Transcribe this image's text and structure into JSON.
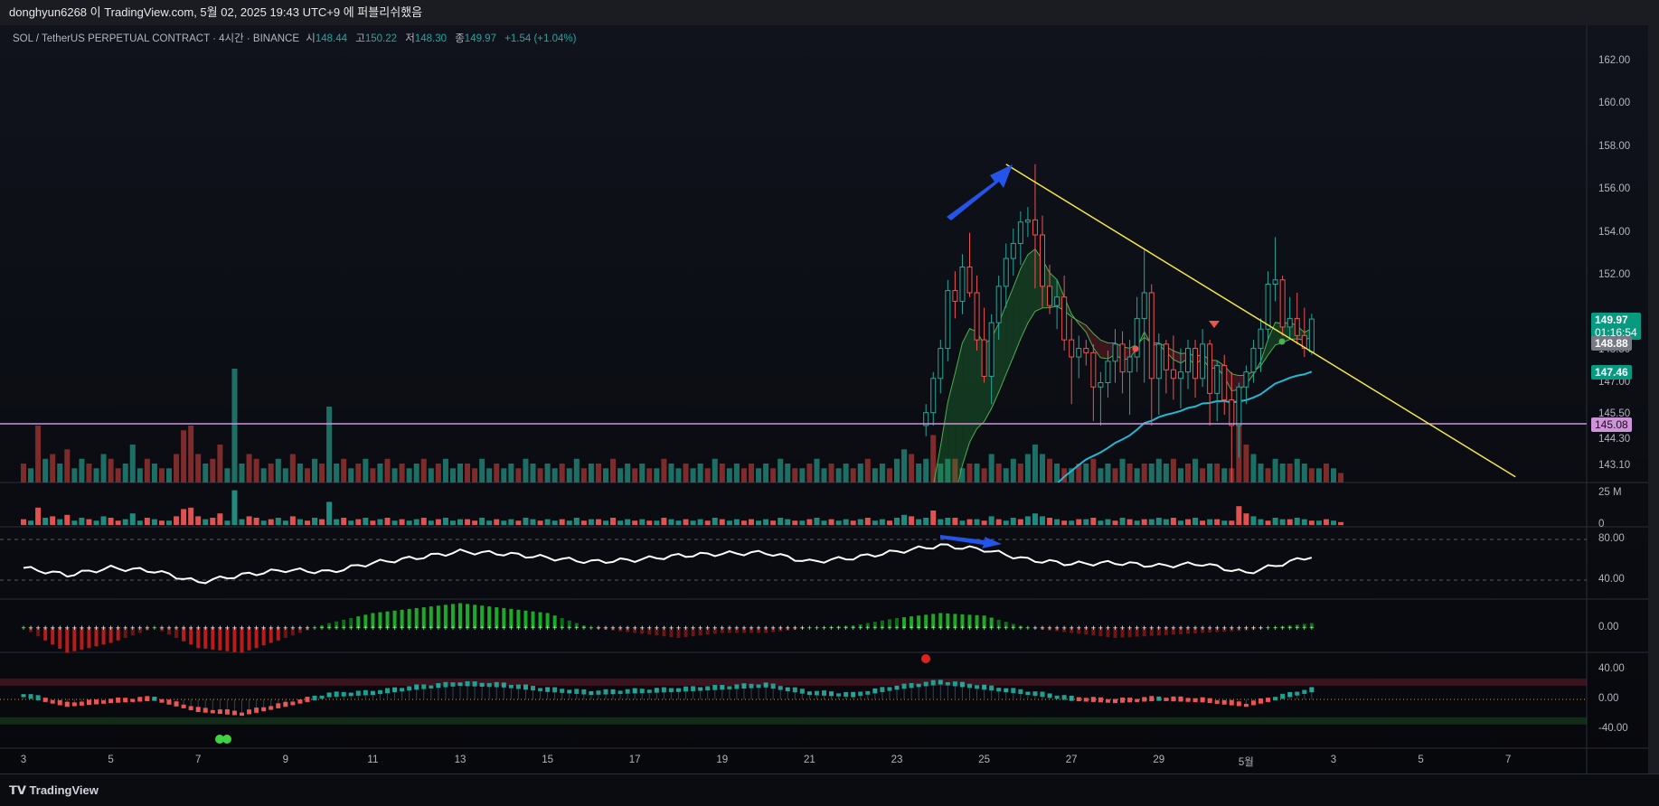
{
  "header": {
    "text": "donghyun6268 이 TradingView.com, 5월 02, 2025 19:43 UTC+9 에 퍼블리쉬했음"
  },
  "legend": {
    "symbol": "SOL / TetherUS PERPETUAL CONTRACT · 4시간 · BINANCE",
    "open_label": "시",
    "open": "148.44",
    "high_label": "고",
    "high": "150.22",
    "low_label": "저",
    "low": "148.30",
    "close_label": "종",
    "close": "149.97",
    "change": "+1.54 (+1.04%)"
  },
  "price_axis": [
    "162.00",
    "160.00",
    "158.00",
    "156.00",
    "154.00",
    "152.00",
    "148.50",
    "147.00",
    "145.50",
    "144.30",
    "143.10"
  ],
  "badges": {
    "last_price": "149.97",
    "countdown": "01:16:54",
    "prev": "148.88",
    "ema": "147.46",
    "hline": "145.08"
  },
  "volume_axis": [
    "25 M",
    "0"
  ],
  "rsi_axis": [
    "80.00",
    "40.00"
  ],
  "macd_axis": [
    "0.00"
  ],
  "osc_axis": [
    "40.00",
    "0.00",
    "-40.00"
  ],
  "time_axis": [
    "3",
    "5",
    "7",
    "9",
    "11",
    "13",
    "15",
    "17",
    "19",
    "21",
    "23",
    "25",
    "27",
    "29",
    "5월",
    "3",
    "5",
    "7"
  ],
  "footer": {
    "brand": "TradingView"
  },
  "colors": {
    "up": "#26a69a",
    "down": "#ef5350",
    "trendline": "#f5e642",
    "hline": "#ce93d8",
    "ema": "#22b8d6",
    "arrow": "#2455e8"
  },
  "chart_data": {
    "type": "candlestick",
    "first_candle_bar": 124,
    "candles": [
      [
        145.0,
        146.0,
        144.5,
        145.6
      ],
      [
        145.6,
        147.5,
        145.0,
        147.2
      ],
      [
        147.2,
        149.0,
        146.5,
        148.6
      ],
      [
        148.6,
        151.8,
        148.0,
        151.3
      ],
      [
        151.3,
        152.2,
        150.0,
        150.8
      ],
      [
        150.8,
        153.0,
        150.2,
        152.4
      ],
      [
        152.4,
        154.0,
        151.0,
        151.2
      ],
      [
        151.2,
        152.0,
        148.5,
        149.0
      ],
      [
        149.0,
        150.5,
        147.0,
        147.3
      ],
      [
        147.3,
        150.2,
        146.0,
        149.8
      ],
      [
        149.8,
        152.0,
        149.0,
        151.5
      ],
      [
        151.5,
        153.5,
        150.5,
        152.8
      ],
      [
        152.8,
        154.2,
        152.0,
        153.5
      ],
      [
        153.5,
        155.0,
        152.5,
        154.5
      ],
      [
        154.5,
        155.2,
        153.8,
        154.6
      ],
      [
        154.6,
        157.2,
        151.4,
        153.9
      ],
      [
        153.9,
        154.8,
        150.5,
        151.5
      ],
      [
        151.5,
        152.5,
        150.2,
        150.6
      ],
      [
        150.6,
        151.8,
        149.5,
        151.0
      ],
      [
        151.0,
        152.0,
        148.5,
        149.0
      ],
      [
        149.0,
        150.0,
        146.0,
        148.2
      ],
      [
        148.2,
        149.2,
        147.2,
        148.6
      ],
      [
        148.6,
        149.0,
        147.8,
        148.4
      ],
      [
        148.4,
        148.8,
        145.2,
        146.8
      ],
      [
        146.8,
        147.5,
        145.0,
        147.0
      ],
      [
        147.0,
        148.5,
        146.3,
        148.0
      ],
      [
        148.0,
        149.5,
        147.0,
        148.8
      ],
      [
        148.8,
        149.4,
        146.5,
        147.5
      ],
      [
        147.5,
        149.0,
        145.5,
        148.2
      ],
      [
        148.2,
        151.0,
        147.5,
        150.0
      ],
      [
        150.0,
        153.2,
        147.0,
        151.2
      ],
      [
        151.2,
        151.6,
        145.0,
        147.2
      ],
      [
        147.2,
        149.3,
        145.5,
        148.8
      ],
      [
        148.8,
        149.0,
        146.5,
        147.6
      ],
      [
        147.6,
        149.2,
        146.2,
        147.2
      ],
      [
        147.2,
        148.6,
        145.8,
        147.5
      ],
      [
        147.5,
        149.0,
        146.7,
        148.6
      ],
      [
        148.6,
        149.0,
        146.3,
        147.2
      ],
      [
        147.2,
        149.5,
        146.8,
        148.8
      ],
      [
        148.8,
        149.0,
        145.0,
        146.5
      ],
      [
        146.5,
        148.0,
        145.2,
        147.8
      ],
      [
        147.8,
        148.3,
        145.5,
        146.2
      ],
      [
        146.2,
        147.5,
        141.0,
        145.0
      ],
      [
        145.0,
        147.0,
        143.5,
        146.8
      ],
      [
        146.8,
        147.8,
        146.0,
        147.5
      ],
      [
        147.5,
        149.0,
        147.0,
        148.6
      ],
      [
        148.6,
        150.0,
        147.5,
        149.5
      ],
      [
        149.5,
        152.2,
        149.0,
        151.6
      ],
      [
        151.6,
        153.8,
        150.8,
        151.8
      ],
      [
        151.8,
        152.0,
        149.2,
        149.6
      ],
      [
        149.6,
        151.0,
        149.0,
        150.0
      ],
      [
        150.0,
        151.2,
        148.8,
        149.2
      ],
      [
        149.2,
        150.5,
        148.2,
        148.6
      ],
      [
        148.44,
        150.22,
        148.3,
        149.97
      ]
    ],
    "volume_m": [
      -4,
      3,
      -12,
      5,
      -6,
      4,
      -7,
      3,
      5,
      -4,
      3,
      6,
      -5,
      -3,
      4,
      8,
      3,
      -5,
      4,
      -3,
      3,
      -6,
      -11,
      -12,
      -6,
      4,
      -5,
      -8,
      3,
      24,
      4,
      -6,
      -5,
      3,
      -4,
      5,
      3,
      -6,
      4,
      -3,
      5,
      -4,
      16,
      4,
      -5,
      3,
      -4,
      5,
      -3,
      4,
      -5,
      3,
      -4,
      3,
      4,
      -5,
      3,
      -4,
      5,
      3,
      4,
      -4,
      -3,
      5,
      3,
      -4,
      3,
      4,
      -3,
      5,
      4,
      -3,
      4,
      3,
      -4,
      3,
      5,
      -3,
      4,
      -4,
      3,
      -5,
      3,
      4,
      -3,
      4,
      -3,
      3,
      -5,
      4,
      3,
      -4,
      3,
      4,
      -3,
      5,
      -4,
      3,
      4,
      -3,
      -4,
      3,
      4,
      -3,
      5,
      4,
      -3,
      3,
      -4,
      5,
      3,
      -4,
      3,
      4,
      -3,
      4,
      -5,
      3,
      4,
      -3,
      5,
      7,
      -6,
      4,
      5,
      -10,
      4,
      5,
      -5,
      3,
      -4,
      4,
      -3,
      6,
      -4,
      3,
      5,
      -4,
      6,
      8,
      6,
      -5,
      4,
      -3,
      3,
      -4,
      4,
      -5,
      3,
      4,
      -3,
      5,
      -4,
      3,
      -4,
      4,
      5,
      4,
      -5,
      3,
      -4,
      5,
      -3,
      4,
      -4,
      3,
      -3,
      -13,
      -8,
      6,
      4,
      -3,
      5,
      4,
      -4,
      5,
      4,
      -3,
      3,
      -4,
      3,
      -2
    ],
    "rsi_daily": [
      52,
      45,
      52,
      49,
      38,
      45,
      50,
      48,
      57,
      62,
      68,
      66,
      62,
      58,
      60,
      64,
      66,
      67,
      58,
      62,
      68,
      74,
      70,
      60,
      56,
      57,
      54,
      56,
      47,
      58
    ],
    "momentum_daily": [
      0,
      -5,
      -3,
      0,
      -4,
      -5,
      -2,
      1,
      3,
      4,
      5,
      4,
      3,
      0,
      -1,
      -2,
      -1,
      -1,
      0,
      0.5,
      2,
      3,
      2.5,
      0,
      -1,
      -2,
      -1.5,
      -1,
      -0.5,
      0.5
    ],
    "oscillator_daily": [
      5,
      -8,
      -3,
      0,
      -15,
      -20,
      -8,
      5,
      8,
      15,
      20,
      18,
      12,
      8,
      10,
      12,
      15,
      18,
      8,
      5,
      15,
      22,
      15,
      8,
      0,
      -3,
      0,
      -2,
      -8,
      5
    ],
    "hline_price": 145.08,
    "trendline": {
      "from": [
        135,
        157.2
      ],
      "to": [
        205,
        142.6
      ]
    }
  }
}
